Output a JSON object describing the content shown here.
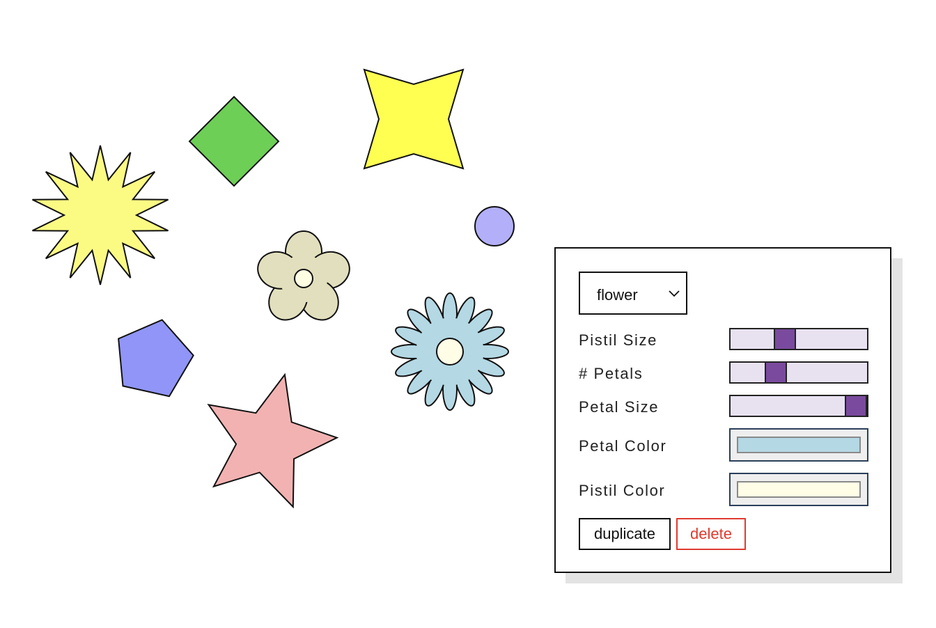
{
  "palette": {
    "starburst": "#fbfb84",
    "diamond": "#6ecf57",
    "four_point_star": "#ffff52",
    "circle": "#b3aff8",
    "flower_beige_petals": "#e2dfbe",
    "flower_beige_pistil": "#fefee2",
    "flower_blue_petals": "#b4d8e4",
    "flower_blue_pistil": "#fffde6",
    "pentagon": "#9095f7",
    "star": "#f2b2b2",
    "stroke": "#111111"
  },
  "canvas": {
    "shapes": [
      {
        "kind": "starburst",
        "name": "starburst-shape"
      },
      {
        "kind": "diamond",
        "name": "diamond-shape"
      },
      {
        "kind": "four-point-star",
        "name": "four-point-star-shape"
      },
      {
        "kind": "circle",
        "name": "circle-shape"
      },
      {
        "kind": "flower",
        "name": "flower-shape-beige",
        "petals": 5
      },
      {
        "kind": "flower",
        "name": "flower-shape-blue",
        "petals": 16
      },
      {
        "kind": "pentagon",
        "name": "pentagon-shape"
      },
      {
        "kind": "star",
        "name": "star-shape"
      }
    ]
  },
  "panel": {
    "shape_type": {
      "selected": "flower",
      "icon": "chevron-down-icon"
    },
    "controls": [
      {
        "label": "Pistil Size",
        "value": 0.38
      },
      {
        "label": "# Petals",
        "value": 0.3
      },
      {
        "label": "Petal Size",
        "value": 1.0
      }
    ],
    "colors": {
      "petal_color_label": "Petal Color",
      "petal_color": "#b4d8e4",
      "pistil_color_label": "Pistil Color",
      "pistil_color": "#fffde6"
    },
    "buttons": {
      "duplicate": "duplicate",
      "delete": "delete"
    }
  }
}
